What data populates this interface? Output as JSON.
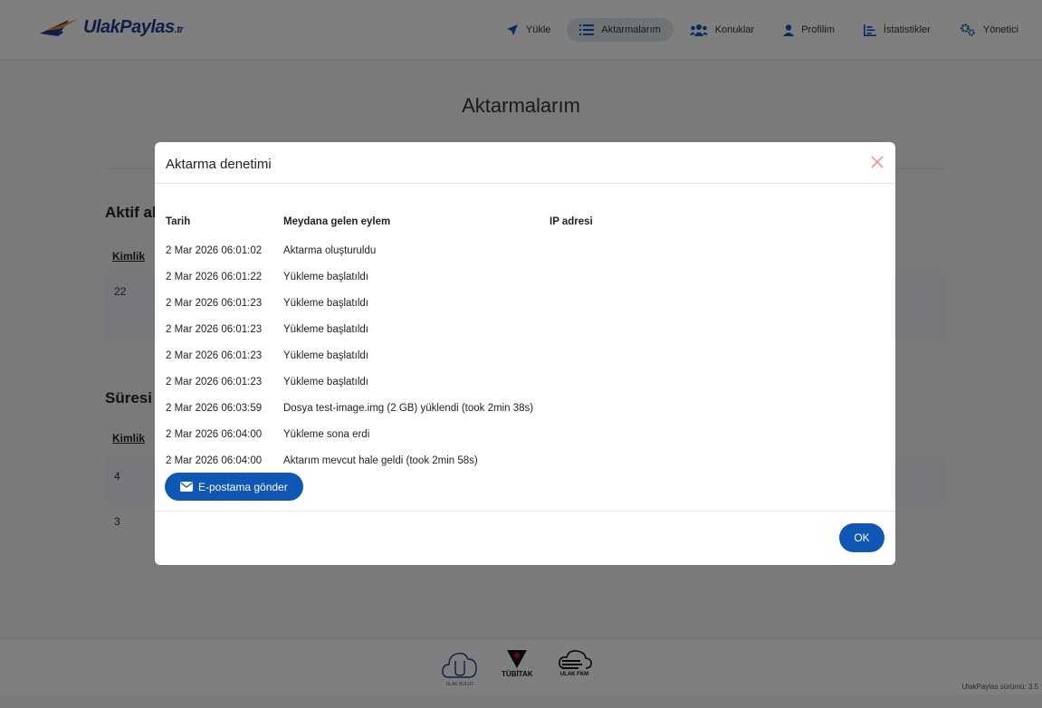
{
  "brand": {
    "name": "UlakPaylas",
    "tld": ".tr"
  },
  "nav": {
    "items": [
      {
        "label": "Yükle",
        "icon": "paper-plane-icon",
        "active": false
      },
      {
        "label": "Aktarmalarım",
        "icon": "list-icon",
        "active": true
      },
      {
        "label": "Konuklar",
        "icon": "users-icon",
        "active": false
      },
      {
        "label": "Profilim",
        "icon": "user-icon",
        "active": false
      },
      {
        "label": "İstatistikler",
        "icon": "chart-icon",
        "active": false
      },
      {
        "label": "Yönetici",
        "icon": "gears-icon",
        "active": false
      }
    ]
  },
  "page": {
    "title": "Aktarmalarım",
    "active_section": {
      "title": "Aktif ak",
      "column_header": "Kimlik",
      "rows": [
        {
          "id": "22"
        }
      ]
    },
    "expired_section": {
      "title": "Süresi d",
      "column_header": "Kimlik",
      "rows": [
        {
          "id": "4"
        },
        {
          "id": "3"
        }
      ]
    }
  },
  "modal": {
    "title": "Aktarma denetimi",
    "close_icon": "close-icon",
    "columns": {
      "date": "Tarih",
      "action": "Meydana gelen eylem",
      "ip": "IP adresi"
    },
    "rows": [
      {
        "date": "2 Mar 2026 06:01:02",
        "action": "Aktarma oluşturuldu",
        "ip": ""
      },
      {
        "date": "2 Mar 2026 06:01:22",
        "action": "Yükleme başlatıldı",
        "ip": ""
      },
      {
        "date": "2 Mar 2026 06:01:23",
        "action": "Yükleme başlatıldı",
        "ip": ""
      },
      {
        "date": "2 Mar 2026 06:01:23",
        "action": "Yükleme başlatıldı",
        "ip": ""
      },
      {
        "date": "2 Mar 2026 06:01:23",
        "action": "Yükleme başlatıldı",
        "ip": ""
      },
      {
        "date": "2 Mar 2026 06:01:23",
        "action": "Yükleme başlatıldı",
        "ip": ""
      },
      {
        "date": "2 Mar 2026 06:03:59",
        "action": "Dosya test-image.img (2 GB) yüklendi (took 2min 38s)",
        "ip": ""
      },
      {
        "date": "2 Mar 2026 06:04:00",
        "action": "Yükleme sona erdi",
        "ip": ""
      },
      {
        "date": "2 Mar 2026 06:04:00",
        "action": "Aktarım mevcut hale geldi (took 2min 58s)",
        "ip": ""
      }
    ],
    "email_button": "E-postama gönder",
    "ok_button": "OK"
  },
  "footer": {
    "logos": [
      {
        "caption": "ULAK BULUT",
        "text": ""
      },
      {
        "caption": "",
        "text": "TÜBİTAK"
      },
      {
        "caption": "",
        "text": "ULAK FKM"
      }
    ],
    "version": "UlakPaylas sürümü: 3.5"
  },
  "colors": {
    "primary": "#0e57b4",
    "brand": "#1a3f8f",
    "accent_orange": "#f28c1a",
    "close": "#e88"
  }
}
